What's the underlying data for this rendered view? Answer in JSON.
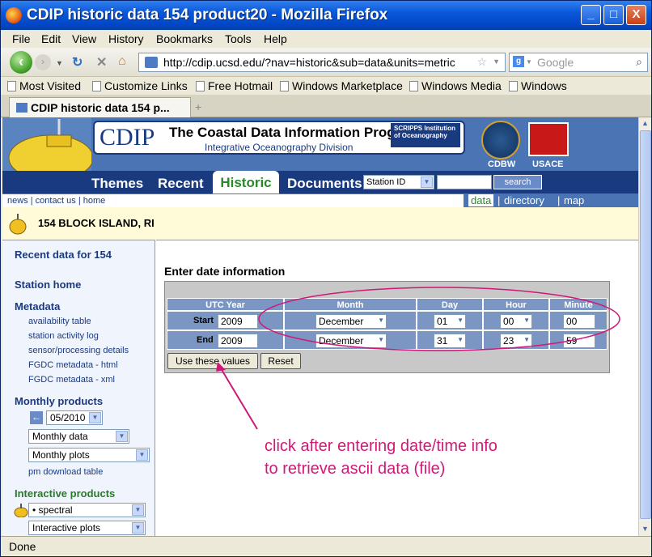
{
  "window": {
    "title": "CDIP historic data 154 product20 - Mozilla Firefox",
    "min": "_",
    "max": "□",
    "close": "X"
  },
  "menu": [
    "File",
    "Edit",
    "View",
    "History",
    "Bookmarks",
    "Tools",
    "Help"
  ],
  "nav": {
    "url": "http://cdip.ucsd.edu/?nav=historic&sub=data&units=metric",
    "search_placeholder": "Google"
  },
  "bookmarks": [
    "Most Visited",
    "Customize Links",
    "Free Hotmail",
    "Windows Marketplace",
    "Windows Media",
    "Windows"
  ],
  "tab": {
    "label": "CDIP historic data 154 p...",
    "new": "+"
  },
  "site": {
    "logo": "CDIP",
    "program": "The Coastal Data Information Program",
    "division": "Integrative Oceanography Division",
    "scripps": "SCRIPPS Institution of Oceanography",
    "cdbw": "CDBW",
    "usace": "USACE",
    "nav": [
      "Themes",
      "Recent",
      "Historic",
      "Documents"
    ],
    "station_select": "Station ID",
    "search_label": "search",
    "links": "news | contact us | home",
    "subnav": {
      "data": "data",
      "directory": "directory",
      "map": "map",
      "sep": "|"
    }
  },
  "station": {
    "name": "154 BLOCK ISLAND, RI"
  },
  "sidebar": {
    "recent": "Recent data for 154",
    "home": "Station home",
    "metadata": "Metadata",
    "metadata_links": [
      "availability table",
      "station activity log",
      "sensor/processing details",
      "FGDC metadata - html",
      "FGDC metadata - xml"
    ],
    "monthly": "Monthly products",
    "month_value": "05/2010",
    "monthly_type": "Monthly data",
    "monthly_plots": "Monthly plots",
    "pm_download": "pm download table",
    "interactive": "Interactive products",
    "spectral": "• spectral",
    "interactive_plots": "Interactive plots"
  },
  "form": {
    "title": "Enter date information",
    "headers": [
      "UTC Year",
      "Month",
      "Day",
      "Hour",
      "Minute"
    ],
    "start": {
      "label": "Start",
      "year": "2009",
      "month": "December",
      "day": "01",
      "hour": "00",
      "minute": "00"
    },
    "end": {
      "label": "End",
      "year": "2009",
      "month": "December",
      "day": "31",
      "hour": "23",
      "minute": "59"
    },
    "use_button": "Use these values",
    "reset_button": "Reset"
  },
  "annotation": {
    "line1": "click after entering date/time info",
    "line2": "to retrieve ascii data (file)"
  },
  "status": "Done",
  "colors": {
    "annotation": "#d01878",
    "nav_bg": "#1a3a80",
    "table_bg": "#7c96c4"
  }
}
